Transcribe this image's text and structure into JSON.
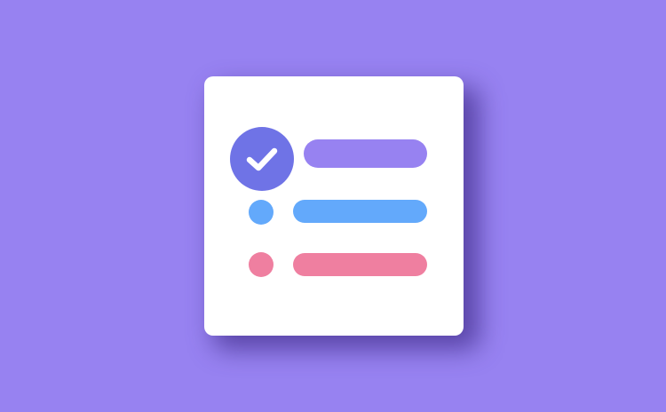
{
  "colors": {
    "background": "#9782f1",
    "card": "#ffffff",
    "check_badge": "#6f73e6",
    "check_mark": "#ffffff",
    "bar_purple": "#9782f1",
    "dot_blue": "#63a9fb",
    "bar_blue": "#63a9fb",
    "dot_pink": "#ef7fa0",
    "bar_pink": "#ef7fa0"
  },
  "icons": {
    "app": "checklist-icon",
    "check": "check-icon"
  },
  "items": [
    {
      "state": "checked"
    },
    {
      "state": "unchecked"
    },
    {
      "state": "unchecked"
    }
  ]
}
